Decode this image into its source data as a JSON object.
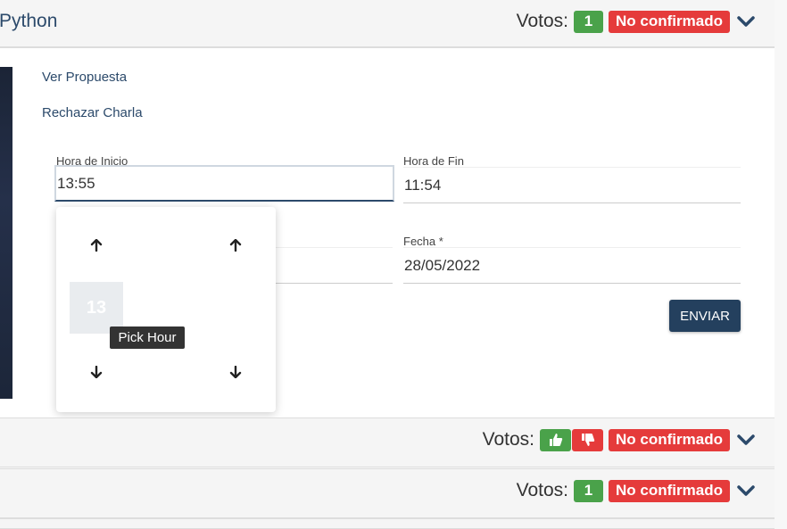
{
  "panels": [
    {
      "title": "Python",
      "votes_label": "Votos:",
      "count": "1",
      "status": "No confirmado"
    },
    {
      "votes_label": "Votos:",
      "status": "No confirmado"
    },
    {
      "votes_label": "Votos:",
      "count": "1",
      "status": "No confirmado"
    }
  ],
  "links": {
    "view": "Ver Propuesta",
    "reject": "Rechazar Charla"
  },
  "form": {
    "start_label": "Hora de Inicio",
    "start_value": "13:55",
    "end_label": "Hora de Fin",
    "end_value": "11:54",
    "date_label": "Fecha *",
    "date_value": "28/05/2022",
    "submit": "ENVIAR"
  },
  "picker": {
    "hour": "13",
    "tooltip": "Pick Hour"
  },
  "colors": {
    "green": "#4aa24a",
    "red": "#e53b3b",
    "navy": "#24405e",
    "link": "#2c4a6b"
  },
  "icons": [
    "chevron-down-icon",
    "thumbs-up-icon",
    "thumbs-down-icon",
    "arrow-up-icon",
    "arrow-down-icon"
  ]
}
